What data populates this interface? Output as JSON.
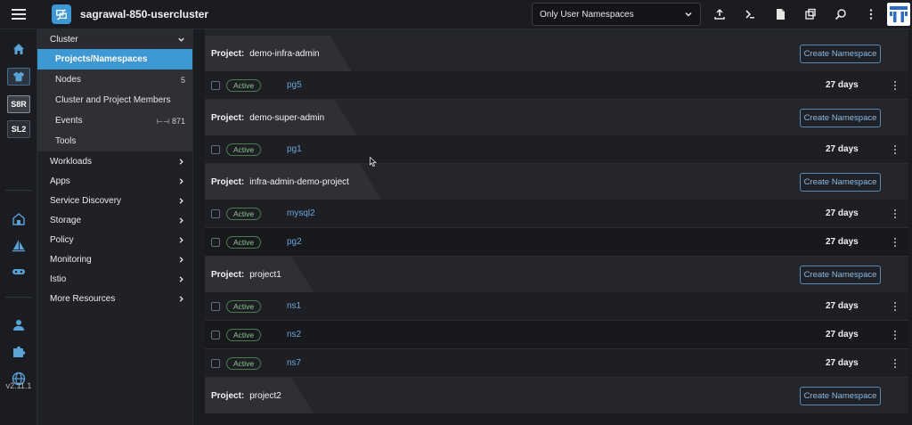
{
  "app": {
    "cluster_name": "sagrawal-850-usercluster",
    "namespace_filter": "Only User Namespaces",
    "version": "v2.11.1"
  },
  "rail": {
    "items": [
      {
        "name": "home-icon"
      },
      {
        "name": "shirt-icon"
      },
      {
        "label": "S8R"
      },
      {
        "label": "SL2"
      },
      {
        "name": "barn-icon"
      },
      {
        "name": "sail-icon"
      },
      {
        "name": "storage-icon"
      },
      {
        "name": "user-icon"
      },
      {
        "name": "puzzle-icon"
      },
      {
        "name": "globe-icon"
      }
    ]
  },
  "sidenav": {
    "cluster": {
      "label": "Cluster",
      "items": [
        {
          "label": "Projects/Namespaces",
          "count": ""
        },
        {
          "label": "Nodes",
          "count": "5"
        },
        {
          "label": "Cluster and Project Members",
          "count": ""
        },
        {
          "label": "Events",
          "count": "871"
        },
        {
          "label": "Tools",
          "count": ""
        }
      ]
    },
    "groups": [
      "Workloads",
      "Apps",
      "Service Discovery",
      "Storage",
      "Policy",
      "Monitoring",
      "Istio",
      "More Resources"
    ]
  },
  "main": {
    "project_label": "Project:",
    "create_label": "Create Namespace",
    "projects": [
      {
        "name": "demo-infra-admin",
        "namespaces": [
          {
            "state": "Active",
            "name": "pg5",
            "age": "27 days"
          }
        ]
      },
      {
        "name": "demo-super-admin",
        "namespaces": [
          {
            "state": "Active",
            "name": "pg1",
            "age": "27 days"
          }
        ]
      },
      {
        "name": "infra-admin-demo-project",
        "namespaces": [
          {
            "state": "Active",
            "name": "mysql2",
            "age": "27 days"
          },
          {
            "state": "Active",
            "name": "pg2",
            "age": "27 days"
          }
        ]
      },
      {
        "name": "project1",
        "namespaces": [
          {
            "state": "Active",
            "name": "ns1",
            "age": "27 days"
          },
          {
            "state": "Active",
            "name": "ns2",
            "age": "27 days"
          },
          {
            "state": "Active",
            "name": "ns7",
            "age": "27 days"
          }
        ]
      },
      {
        "name": "project2",
        "namespaces": []
      }
    ]
  },
  "colors": {
    "accent": "#3d98d3",
    "background": "#1b1c21",
    "active_badge": "#8bc88f",
    "link": "#6aa5d6"
  }
}
